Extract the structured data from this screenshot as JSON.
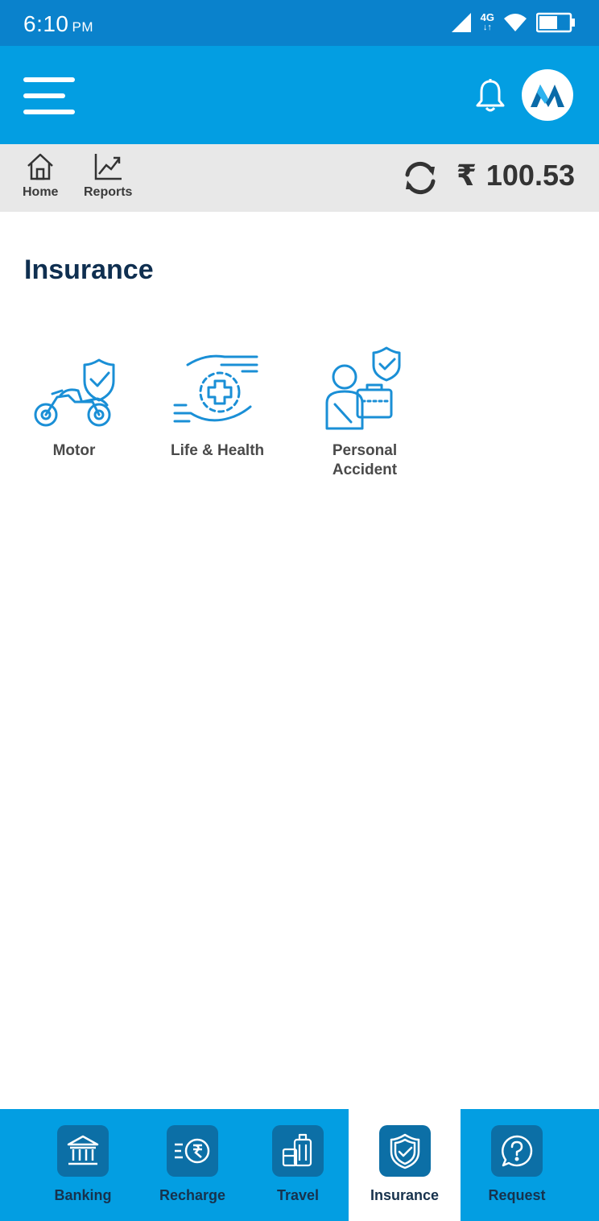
{
  "status_bar": {
    "time": "6:10",
    "ampm": "PM",
    "network": "4G"
  },
  "header": {
    "menu_icon": "hamburger-menu-icon",
    "notification_icon": "bell-icon",
    "logo_icon": "brand-logo-icon"
  },
  "sub_bar": {
    "home_label": "Home",
    "reports_label": "Reports",
    "currency_symbol": "₹",
    "balance": "100.53"
  },
  "main": {
    "title": "Insurance",
    "tiles": [
      {
        "label": "Motor",
        "icon": "motorbike-shield-icon"
      },
      {
        "label": "Life & Health",
        "icon": "hands-medical-cross-icon"
      },
      {
        "label_line1": "Personal",
        "label_line2": "Accident",
        "icon": "injured-person-briefcase-icon"
      }
    ]
  },
  "bottom_nav": {
    "items": [
      {
        "label": "Banking",
        "icon": "bank-icon"
      },
      {
        "label": "Recharge",
        "icon": "rupee-coin-icon"
      },
      {
        "label": "Travel",
        "icon": "luggage-icon"
      },
      {
        "label": "Insurance",
        "icon": "shield-check-icon"
      },
      {
        "label": "Request",
        "icon": "question-bubble-icon"
      }
    ],
    "active": "Insurance"
  },
  "colors": {
    "status_bar": "#0a82cc",
    "header": "#039ee2",
    "nav_tile": "#0c6fa6",
    "title": "#0f2f50",
    "icon_blue": "#1a8fd6"
  }
}
